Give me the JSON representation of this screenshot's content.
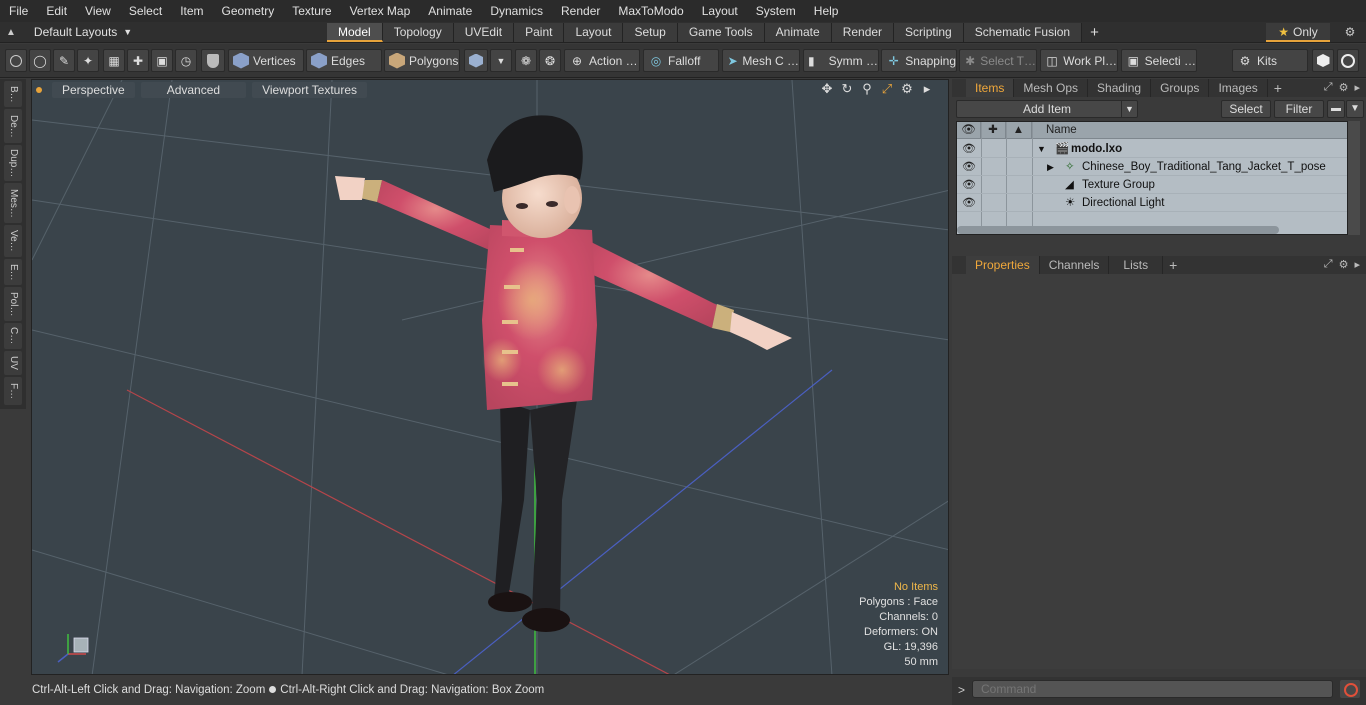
{
  "menu": [
    "File",
    "Edit",
    "View",
    "Select",
    "Item",
    "Geometry",
    "Texture",
    "Vertex Map",
    "Animate",
    "Dynamics",
    "Render",
    "MaxToModo",
    "Layout",
    "System",
    "Help"
  ],
  "layout_selector": "Default Layouts",
  "tabs": [
    "Model",
    "Topology",
    "UVEdit",
    "Paint",
    "Layout",
    "Setup",
    "Game Tools",
    "Animate",
    "Render",
    "Scripting",
    "Schematic Fusion"
  ],
  "only_label": "Only",
  "toolbar": {
    "vertices": "Vertices",
    "edges": "Edges",
    "polygons": "Polygons",
    "action": "Action …",
    "falloff": "Falloff",
    "mesh": "Mesh C …",
    "symm": "Symm …",
    "snapping": "Snapping",
    "select_t": "Select T…",
    "work_pl": "Work Pl…",
    "selecti": "Selecti …",
    "kits": "Kits"
  },
  "left_tabs": [
    "B…",
    "De…",
    "Dup…",
    "Mes…",
    "Ve…",
    "E…",
    "Pol…",
    "C…",
    "UV",
    "F…"
  ],
  "viewport": {
    "perspective": "Perspective",
    "advanced": "Advanced",
    "viewport_textures": "Viewport Textures",
    "info": {
      "no_items": "No Items",
      "polygons": "Polygons : Face",
      "channels": "Channels: 0",
      "deformers": "Deformers: ON",
      "gl": "GL: 19,396",
      "mm": "50 mm"
    }
  },
  "status": {
    "left": "Ctrl-Alt-Left Click and Drag: Navigation: Zoom",
    "right": "Ctrl-Alt-Right Click and Drag: Navigation: Box Zoom"
  },
  "items_panel": {
    "tabs": [
      "Items",
      "Mesh Ops",
      "Shading",
      "Groups",
      "Images"
    ],
    "add_item": "Add Item",
    "select": "Select",
    "filter": "Filter",
    "col_name": "Name",
    "rows": [
      {
        "label": "modo.lxo"
      },
      {
        "label": "Chinese_Boy_Traditional_Tang_Jacket_T_pose"
      },
      {
        "label": "Texture Group"
      },
      {
        "label": "Directional Light"
      }
    ]
  },
  "props_panel": {
    "tabs": [
      "Properties",
      "Channels",
      "Lists"
    ]
  },
  "command": {
    "placeholder": "Command"
  },
  "colors": {
    "accent": "#e7a33b",
    "viewport_bg": "#3a444b",
    "jacket": "#d0566e"
  }
}
